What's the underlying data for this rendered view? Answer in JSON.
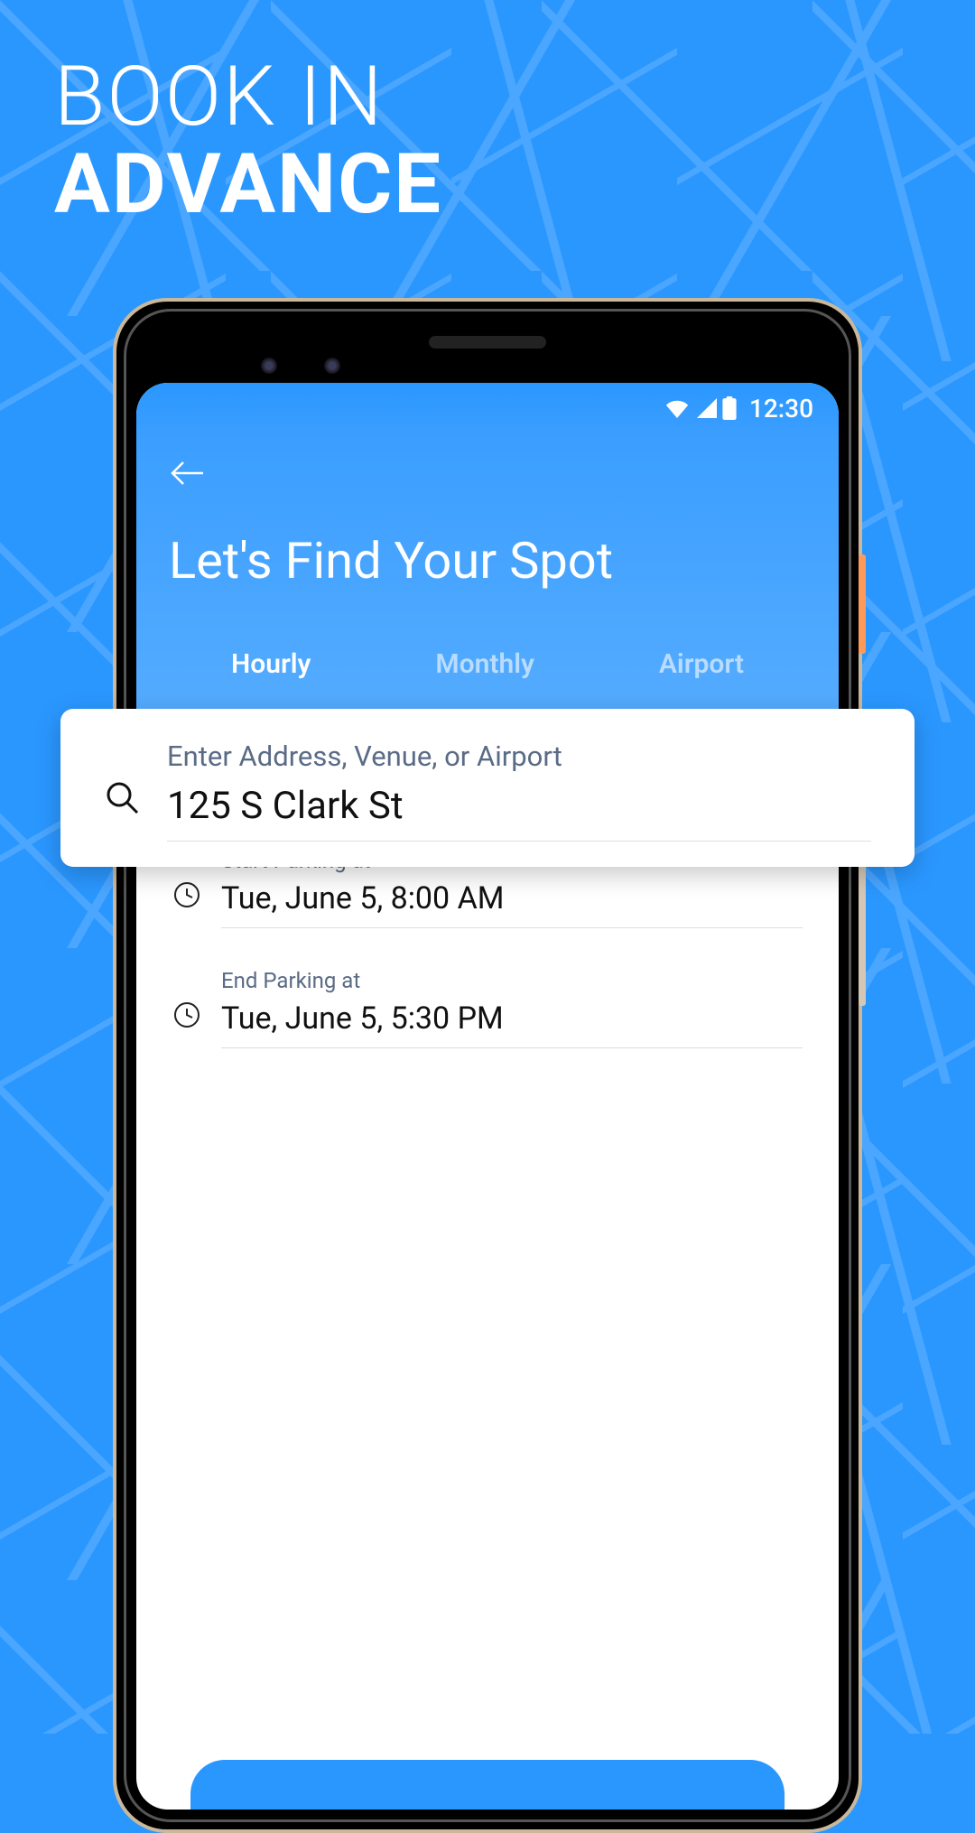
{
  "marketing": {
    "line1": "BOOK IN",
    "line2": "ADVANCE"
  },
  "status_bar": {
    "time": "12:30"
  },
  "header": {
    "title": "Let's Find Your Spot"
  },
  "tabs": [
    {
      "label": "Hourly",
      "active": true
    },
    {
      "label": "Monthly",
      "active": false
    },
    {
      "label": "Airport",
      "active": false
    }
  ],
  "search": {
    "label": "Enter Address, Venue, or Airport",
    "value": "125 S Clark St"
  },
  "start": {
    "label": "Start Parking at",
    "value": "Tue, June 5, 8:00 AM"
  },
  "end": {
    "label": "End Parking at",
    "value": "Tue, June 5, 5:30 PM"
  },
  "icons": {
    "back": "back-arrow-icon",
    "search": "search-icon",
    "clock": "clock-icon",
    "wifi": "wifi-icon",
    "signal": "signal-icon",
    "battery": "battery-icon"
  },
  "colors": {
    "primary": "#2a97ff",
    "text_muted": "#5a6b85"
  }
}
